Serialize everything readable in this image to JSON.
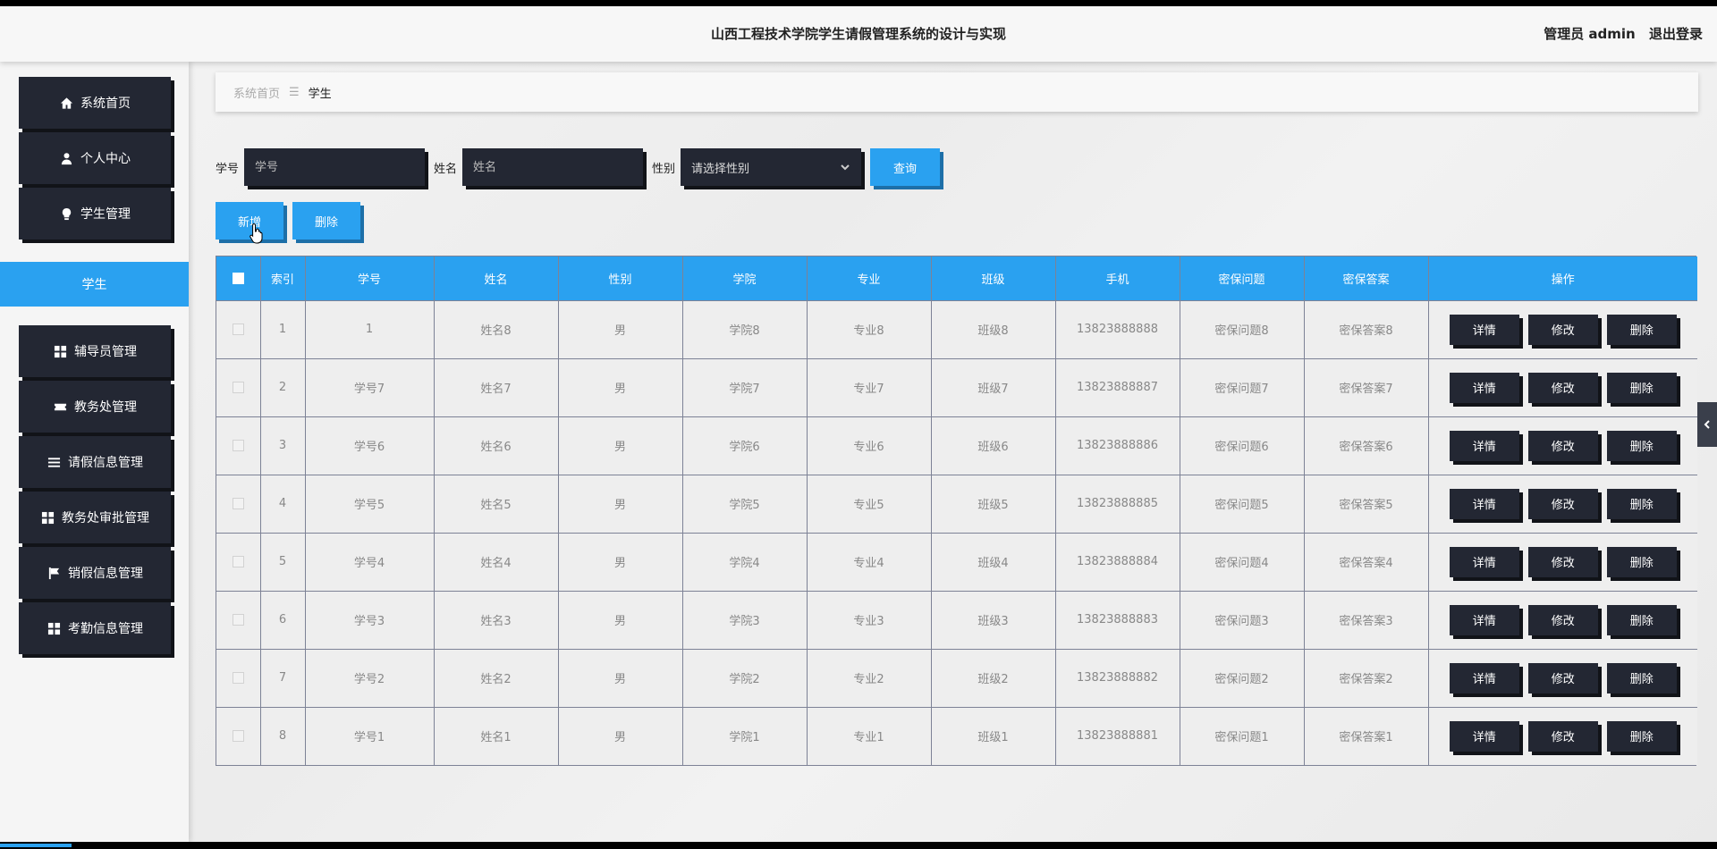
{
  "header": {
    "title": "山西工程技术学院学生请假管理系统的设计与实现",
    "role_user": "管理员 admin",
    "logout": "退出登录"
  },
  "sidebar": {
    "items": [
      {
        "label": "系统首页",
        "icon": "home-icon"
      },
      {
        "label": "个人中心",
        "icon": "user-icon"
      },
      {
        "label": "学生管理",
        "icon": "bulb-icon"
      },
      {
        "label": "辅导员管理",
        "icon": "grid-icon"
      },
      {
        "label": "教务处管理",
        "icon": "ticket-icon"
      },
      {
        "label": "请假信息管理",
        "icon": "list-icon"
      },
      {
        "label": "教务处审批管理",
        "icon": "grid-icon"
      },
      {
        "label": "销假信息管理",
        "icon": "flag-icon"
      },
      {
        "label": "考勤信息管理",
        "icon": "grid-icon"
      }
    ],
    "active_sub": "学生"
  },
  "breadcrumb": {
    "home": "系统首页",
    "separator": "☰",
    "current": "学生"
  },
  "search": {
    "xuehao_label": "学号",
    "xuehao_placeholder": "学号",
    "xingming_label": "姓名",
    "xingming_placeholder": "姓名",
    "xingbie_label": "性别",
    "xingbie_placeholder": "请选择性别",
    "query_button": "查询"
  },
  "actions": {
    "add": "新增",
    "delete": "删除"
  },
  "table": {
    "headers": [
      "索引",
      "学号",
      "姓名",
      "性别",
      "学院",
      "专业",
      "班级",
      "手机",
      "密保问题",
      "密保答案",
      "操作"
    ],
    "row_buttons": {
      "detail": "详情",
      "edit": "修改",
      "delete": "删除"
    },
    "rows": [
      [
        "1",
        "1",
        "姓名8",
        "男",
        "学院8",
        "专业8",
        "班级8",
        "13823888888",
        "密保问题8",
        "密保答案8"
      ],
      [
        "2",
        "学号7",
        "姓名7",
        "男",
        "学院7",
        "专业7",
        "班级7",
        "13823888887",
        "密保问题7",
        "密保答案7"
      ],
      [
        "3",
        "学号6",
        "姓名6",
        "男",
        "学院6",
        "专业6",
        "班级6",
        "13823888886",
        "密保问题6",
        "密保答案6"
      ],
      [
        "4",
        "学号5",
        "姓名5",
        "男",
        "学院5",
        "专业5",
        "班级5",
        "13823888885",
        "密保问题5",
        "密保答案5"
      ],
      [
        "5",
        "学号4",
        "姓名4",
        "男",
        "学院4",
        "专业4",
        "班级4",
        "13823888884",
        "密保问题4",
        "密保答案4"
      ],
      [
        "6",
        "学号3",
        "姓名3",
        "男",
        "学院3",
        "专业3",
        "班级3",
        "13823888883",
        "密保问题3",
        "密保答案3"
      ],
      [
        "7",
        "学号2",
        "姓名2",
        "男",
        "学院2",
        "专业2",
        "班级2",
        "13823888882",
        "密保问题2",
        "密保答案2"
      ],
      [
        "8",
        "学号1",
        "姓名1",
        "男",
        "学院1",
        "专业1",
        "班级1",
        "13823888881",
        "密保问题1",
        "密保答案1"
      ]
    ]
  },
  "colors": {
    "accent": "#2aa1f0",
    "dark": "#232733"
  }
}
